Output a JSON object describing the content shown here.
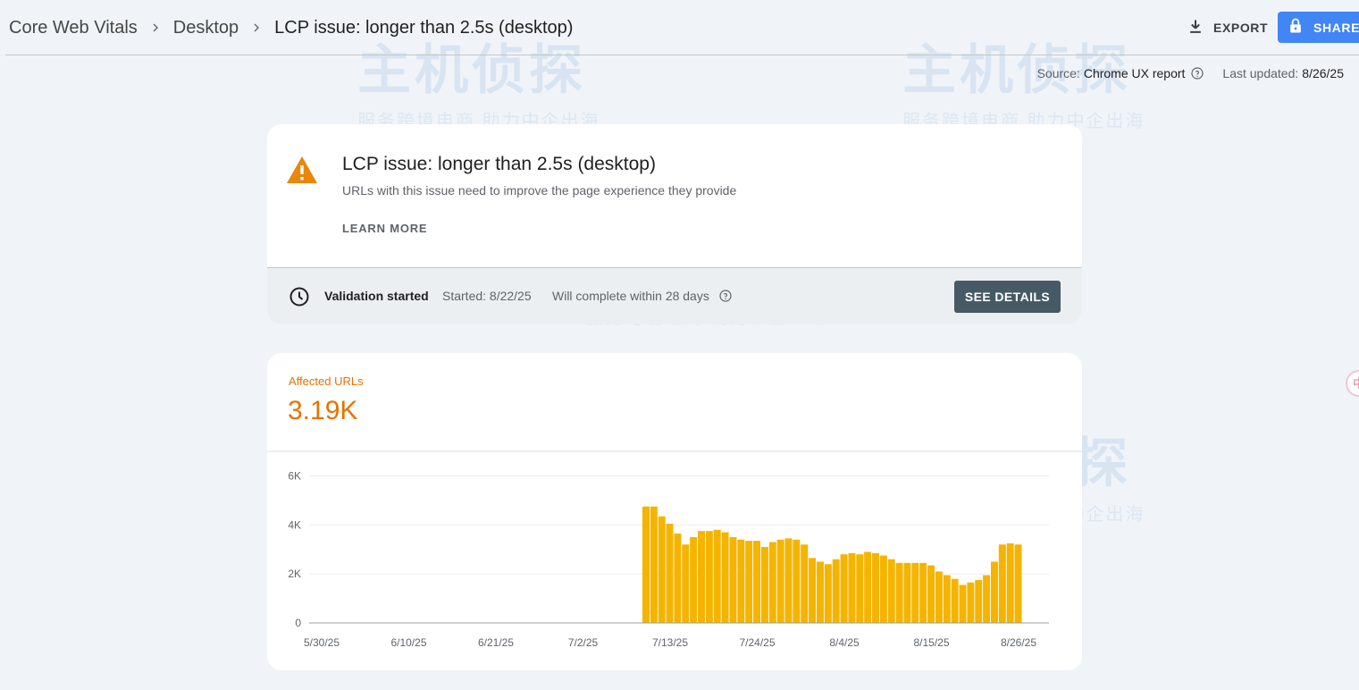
{
  "breadcrumb": {
    "items": [
      "Core Web Vitals",
      "Desktop",
      "LCP issue: longer than 2.5s (desktop)"
    ]
  },
  "toolbar": {
    "export_label": "EXPORT",
    "share_label": "SHARE"
  },
  "source": {
    "label": "Source:",
    "value": "Chrome UX report",
    "updated_label": "Last updated:",
    "updated_value": "8/26/25"
  },
  "issue": {
    "title": "LCP issue: longer than 2.5s (desktop)",
    "subtitle": "URLs with this issue need to improve the page experience they provide",
    "learn_more": "LEARN MORE",
    "warning_color": "#e37400"
  },
  "validation": {
    "status": "Validation started",
    "started": "Started: 8/22/25",
    "complete": "Will complete within 28 days",
    "details_button": "SEE DETAILS"
  },
  "metric": {
    "label": "Affected URLs",
    "value": "3.19K",
    "accent": "#e37400"
  },
  "chart_data": {
    "type": "bar",
    "title": "",
    "xlabel": "",
    "ylabel": "",
    "ylim": [
      0,
      7000
    ],
    "yticks": [
      "0",
      "2K",
      "4K",
      "6K"
    ],
    "ytick_values": [
      0,
      2000,
      4000,
      6000
    ],
    "xtick_labels": [
      "5/30/25",
      "6/10/25",
      "6/21/25",
      "7/2/25",
      "7/13/25",
      "7/24/25",
      "8/4/25",
      "8/15/25",
      "8/26/25"
    ],
    "x_start": "5/30/25",
    "x_end": "8/26/25",
    "bar_color": "#f4b400",
    "first_bar_date": "7/10/25",
    "values": [
      4750,
      4750,
      4350,
      4050,
      3650,
      3200,
      3500,
      3750,
      3750,
      3800,
      3700,
      3500,
      3400,
      3350,
      3350,
      3100,
      3300,
      3400,
      3450,
      3400,
      3200,
      2650,
      2500,
      2400,
      2600,
      2800,
      2850,
      2800,
      2900,
      2850,
      2750,
      2600,
      2450,
      2450,
      2450,
      2450,
      2350,
      2100,
      1950,
      1800,
      1550,
      1650,
      1750,
      1950,
      2500,
      3200,
      3250,
      3200
    ],
    "grid": true
  }
}
